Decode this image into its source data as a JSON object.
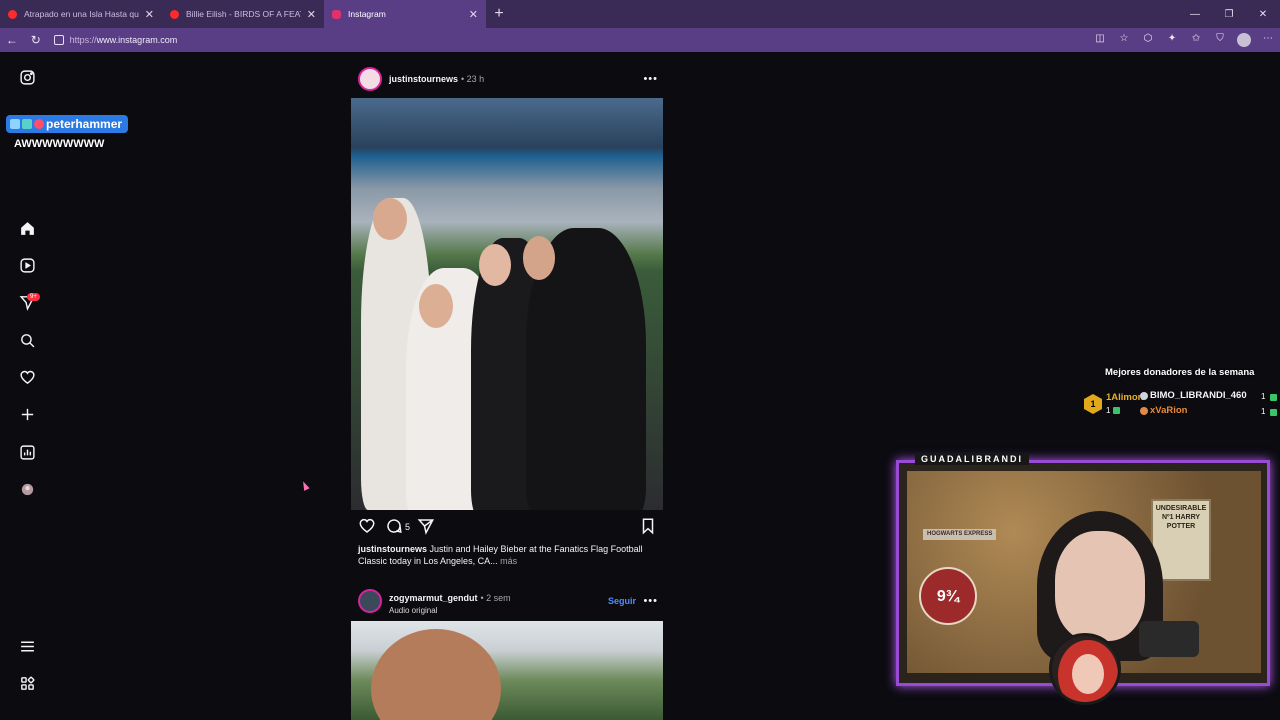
{
  "browser": {
    "tabs": [
      {
        "title": "Atrapado en una Isla Hasta que C",
        "favicon_color": "#ff2a2a",
        "active": false
      },
      {
        "title": "Billie Eilish - BIRDS OF A FEATHER",
        "favicon_color": "#ff2a2a",
        "active": false
      },
      {
        "title": "Instagram",
        "favicon_color": "#e1306c",
        "active": true
      }
    ],
    "new_tab_label": "+",
    "url_protocol": "https://",
    "url_host": "www.instagram.com"
  },
  "overlay_chat": {
    "username": "peterhammer",
    "message": "AWWWWWWWW"
  },
  "sidebar": {
    "notifications_badge": "9+"
  },
  "feed": {
    "post1": {
      "username": "justinstournews",
      "time": "• 23 h",
      "comments_count": "5",
      "caption_user": "justinstournews",
      "caption_text": " Justin and Hailey Bieber at the Fanatics Flag Football Classic today in Los Angeles, CA...",
      "caption_more": " más"
    },
    "post2": {
      "username": "zogymarmut_gendut",
      "time": "• 2 sem",
      "subtitle": "Audio original",
      "follow_label": "Seguir"
    }
  },
  "donors": {
    "title": "Mejores donadores de la semana",
    "first": {
      "rank": "1",
      "name": "1Alimon",
      "count": "1"
    },
    "second": {
      "name": "BIMO_LIBRANDI_460",
      "count": "1"
    },
    "third": {
      "name": "xVaRion",
      "count": "1"
    }
  },
  "webcam": {
    "channel_name": "GUADALIBRANDI",
    "poster_text": "UNDESIRABLE Nº1 HARRY POTTER",
    "hogwarts_sign": "HOGWARTS EXPRESS",
    "platform_sign": "9¾"
  },
  "colors": {
    "tab_bar": "#3a2a56",
    "address_bar": "#5a3e85",
    "page_bg": "#0b0b10",
    "accent_blue": "#4f8cff",
    "cam_border": "#9a4bd6"
  }
}
